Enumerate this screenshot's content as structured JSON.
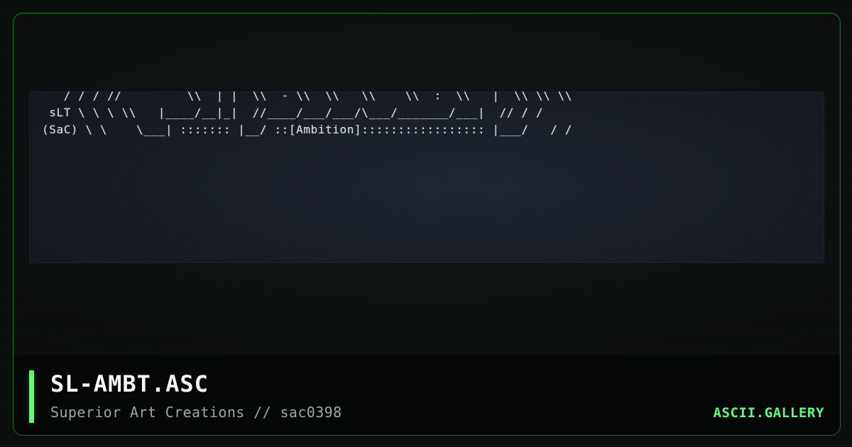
{
  "colors": {
    "accent_green": "#57ff7b",
    "frame_border": "#1e6c2a",
    "footer_bg": "#050707",
    "art_bg": "#171c24",
    "art_text": "#e8edf1",
    "subtitle_text": "#9aa6a8"
  },
  "art": {
    "text": "   / / / //         \\\\  | |  \\\\  - \\\\  \\\\   \\\\    \\\\  :  \\\\   |  \\\\ \\\\ \\\\ \n sLT \\ \\ \\ \\\\   |____/__|_|  //____/___/___/\\___/_______/___|  // / / \n(SaC) \\ \\    \\___| ::::::: |__/ ::[Ambition]::::::::::::::::: |___/   / / "
  },
  "footer": {
    "title": "SL-AMBT.ASC",
    "subtitle": "Superior Art Creations // sac0398",
    "brand": "ASCII.GALLERY"
  }
}
